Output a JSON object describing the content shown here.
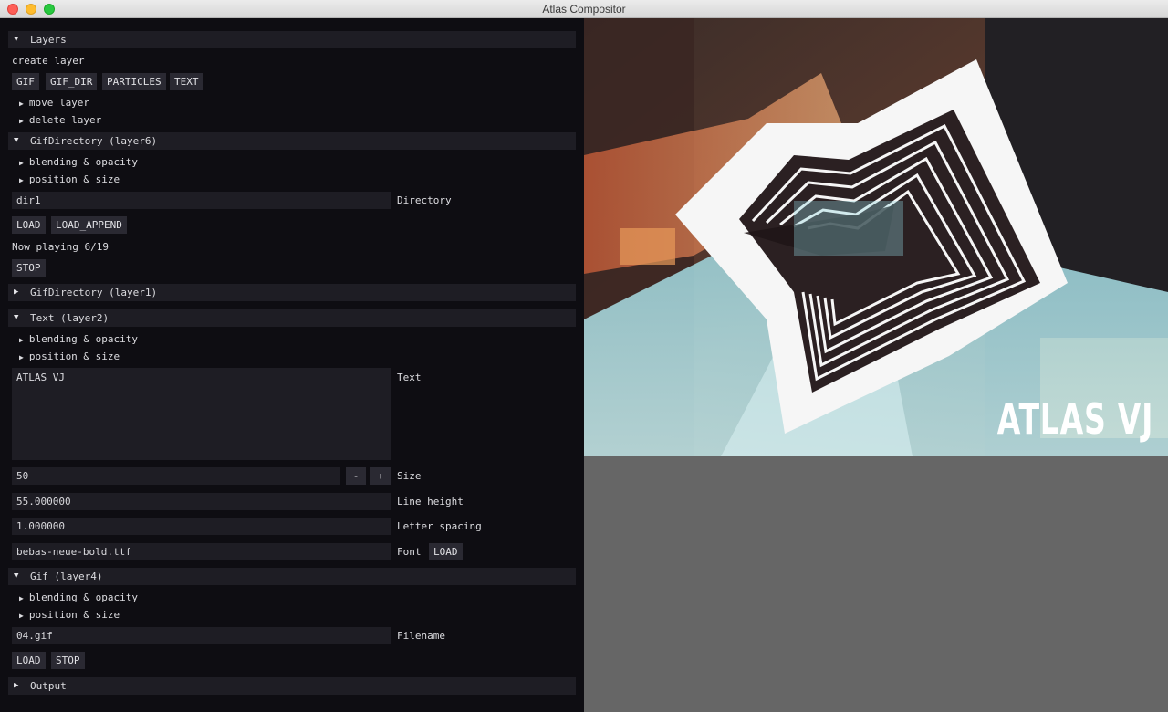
{
  "window": {
    "title": "Atlas Compositor"
  },
  "layers_section": {
    "header": "Layers",
    "create_label": "create layer",
    "create_buttons": [
      "GIF",
      "GIF_DIR",
      "PARTICLES",
      "TEXT"
    ],
    "move_layer": "move layer",
    "delete_layer": "delete layer"
  },
  "gifdir6": {
    "header": "GifDirectory (layer6)",
    "blending": "blending & opacity",
    "position": "position & size",
    "directory_value": "dir1",
    "directory_label": "Directory",
    "load_label": "LOAD",
    "load_append_label": "LOAD_APPEND",
    "now_playing": "Now playing 6/19",
    "stop_label": "STOP"
  },
  "gifdir1": {
    "header": "GifDirectory (layer1)"
  },
  "text2": {
    "header": "Text (layer2)",
    "blending": "blending & opacity",
    "position": "position & size",
    "text_value": "ATLAS VJ",
    "text_label": "Text",
    "size_value": "50",
    "minus_label": "-",
    "plus_label": "+",
    "size_label": "Size",
    "line_height_value": "55.000000",
    "line_height_label": "Line height",
    "letter_spacing_value": "1.000000",
    "letter_spacing_label": "Letter spacing",
    "font_value": "bebas-neue-bold.ttf",
    "font_label": "Font",
    "font_load_label": "LOAD"
  },
  "gif4": {
    "header": "Gif (layer4)",
    "blending": "blending & opacity",
    "position": "position & size",
    "filename_value": "04.gif",
    "filename_label": "Filename",
    "load_label": "LOAD",
    "stop_label": "STOP"
  },
  "output": {
    "header": "Output"
  },
  "preview": {
    "overlay_text": "ATLAS VJ"
  },
  "colors": {
    "panel_bg": "#0e0d12",
    "header_bg": "#1e1d24",
    "button_bg": "#2a2932",
    "gray_area": "#666666"
  },
  "icons": {
    "expanded": "triangle-down-icon",
    "collapsed": "triangle-right-icon"
  }
}
